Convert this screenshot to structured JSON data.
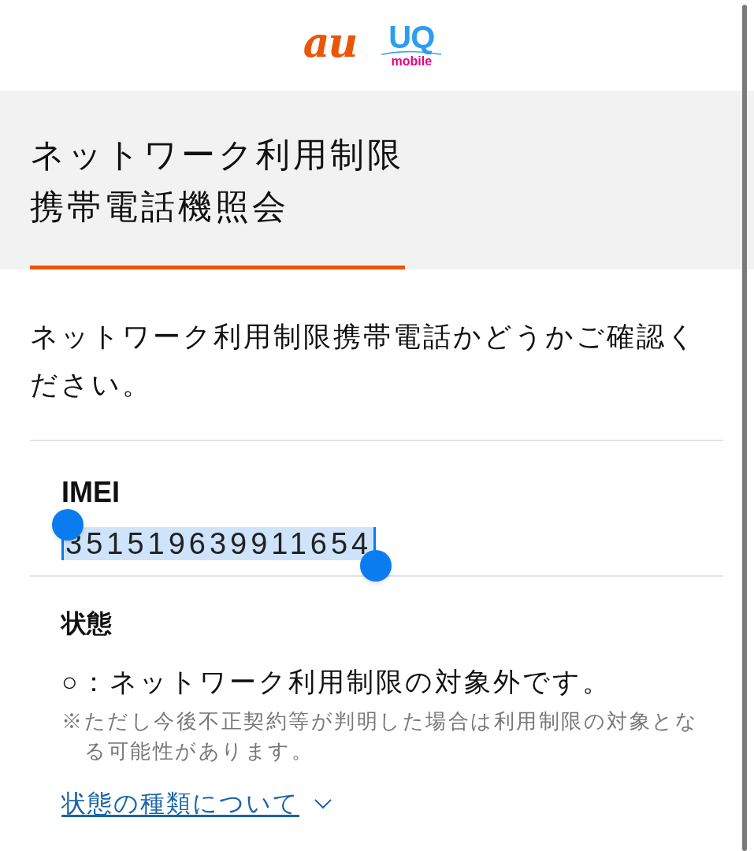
{
  "header": {
    "logos": [
      {
        "kind": "au",
        "text": "au"
      },
      {
        "kind": "uq",
        "text": "UQ",
        "subtext": "mobile"
      }
    ]
  },
  "title_lines": [
    "ネットワーク利用制限",
    "携帯電話機照会"
  ],
  "intro": "ネットワーク利用制限携帯電話かどうかご確認ください。",
  "imei": {
    "label": "IMEI",
    "value": "351519639911654",
    "selected": true
  },
  "status": {
    "label": "状態",
    "result": "○：ネットワーク利用制限の対象外です。",
    "note": "※ただし今後不正契約等が判明した場合は利用制限の対象となる可能性があります。",
    "link": "状態の種類について",
    "expanded": false
  }
}
